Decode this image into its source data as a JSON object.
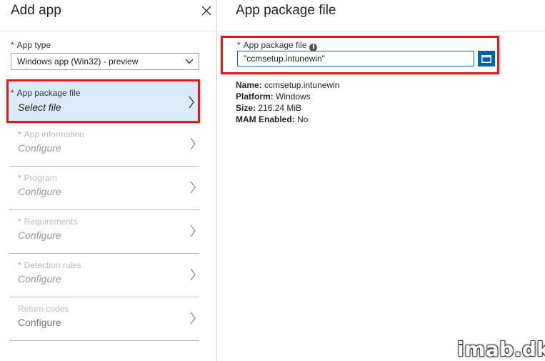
{
  "left": {
    "title": "Add app",
    "app_type": {
      "label": "App type",
      "value": "Windows app (Win32) - preview"
    },
    "steps": [
      {
        "label": "App package file",
        "value": "Select file",
        "required": true
      },
      {
        "label": "App information",
        "value": "Configure",
        "required": true
      },
      {
        "label": "Program",
        "value": "Configure",
        "required": true
      },
      {
        "label": "Requirements",
        "value": "Configure",
        "required": true
      },
      {
        "label": "Detection rules",
        "value": "Configure",
        "required": true
      },
      {
        "label": "Return codes",
        "value": "Configure",
        "required": false
      }
    ]
  },
  "right": {
    "title": "App package file",
    "package_field": {
      "label": "App package file",
      "value": "\"ccmsetup.intunewin\""
    },
    "details": {
      "name_label": "Name:",
      "name_value": "ccmsetup.intunewin",
      "platform_label": "Platform:",
      "platform_value": "Windows",
      "size_label": "Size:",
      "size_value": "216.24 MiB",
      "mam_label": "MAM Enabled:",
      "mam_value": "No"
    }
  },
  "required_marker": "*",
  "watermark": "imab.dk",
  "colors": {
    "accent": "#0063b1",
    "highlight_border": "#e01b1b",
    "active_step_bg": "#dcebf9",
    "required": "#cc0000"
  }
}
